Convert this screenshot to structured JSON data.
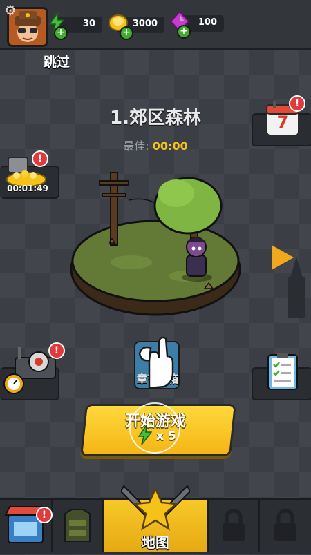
{
  "top_bar": {
    "resources": [
      {
        "name": "energy",
        "value": "30",
        "icon": "lightning-icon",
        "color": "#3fbf3a"
      },
      {
        "name": "coins",
        "value": "3000",
        "icon": "coin-icon",
        "color": "#f5c21a"
      },
      {
        "name": "gems",
        "value": "100",
        "icon": "gem-icon",
        "color": "#c23fc9"
      }
    ]
  },
  "skip_label": "跳过",
  "level": {
    "title": "1.郊区森林",
    "best_label": "最佳:",
    "best_value": "00:00"
  },
  "side": {
    "treasure_timer": "00:01:49",
    "calendar_day": "7"
  },
  "chest_label": "章节宝箱",
  "start_button": {
    "label": "开始游戏",
    "cost": "x 5"
  },
  "bottom_nav": {
    "map_label": "地图"
  },
  "colors": {
    "accent_yellow": "#f4b515",
    "alert_red": "#e23a3a",
    "background": "#3b3f45"
  }
}
